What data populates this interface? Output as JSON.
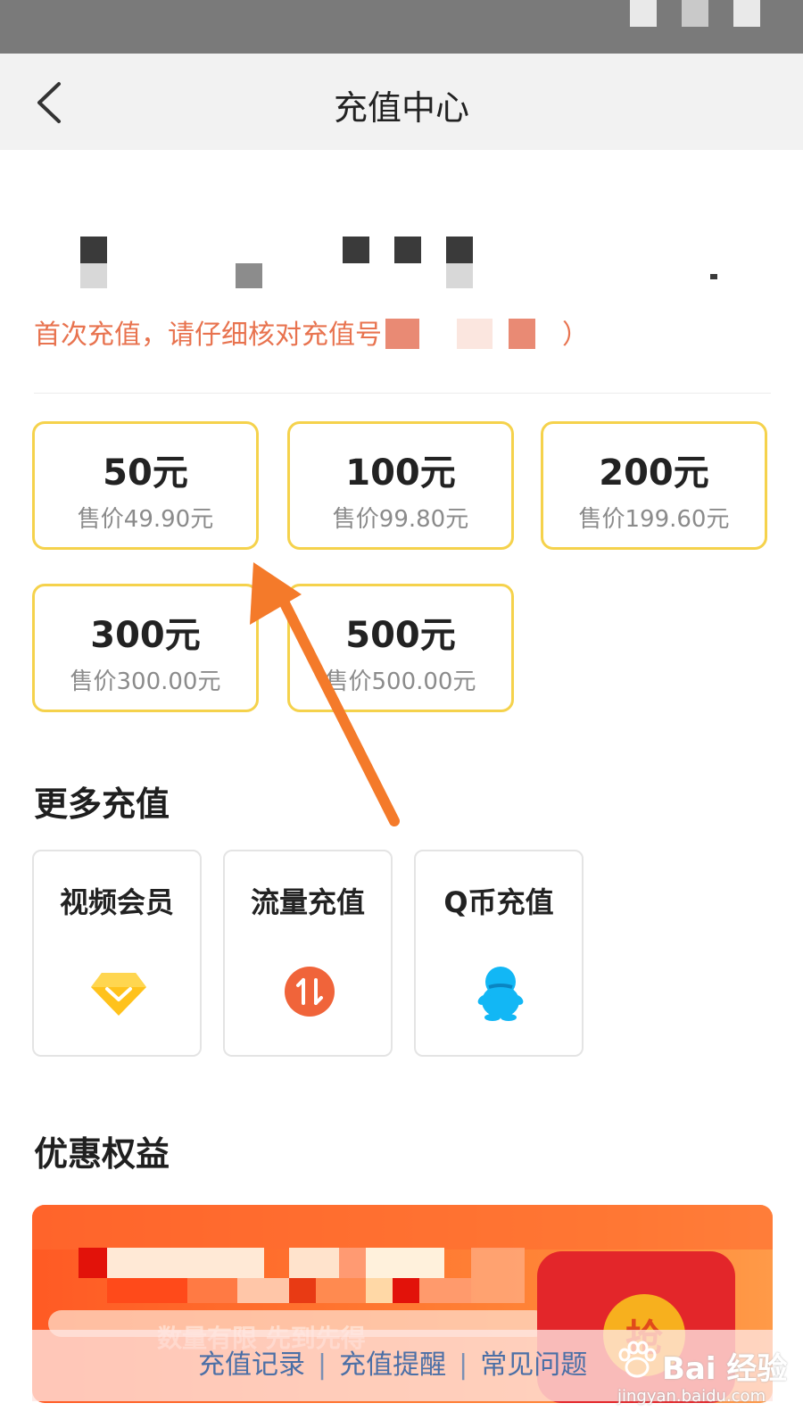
{
  "nav": {
    "title": "充值中心"
  },
  "account": {
    "notice": "首次充值，请仔细核对充值号",
    "notice_tail": "）"
  },
  "amounts": [
    {
      "value": "50元",
      "price": "售价49.90元"
    },
    {
      "value": "100元",
      "price": "售价99.80元"
    },
    {
      "value": "200元",
      "price": "售价199.60元"
    },
    {
      "value": "300元",
      "price": "售价300.00元"
    },
    {
      "value": "500元",
      "price": "售价500.00元"
    }
  ],
  "more": {
    "title": "更多充值",
    "items": [
      {
        "label": "视频会员",
        "icon": "diamond-icon"
      },
      {
        "label": "流量充值",
        "icon": "data-traffic-icon"
      },
      {
        "label": "Q币充值",
        "icon": "qq-penguin-icon"
      }
    ]
  },
  "benefits": {
    "title": "优惠权益",
    "banner_text": "数量有限 先到先得",
    "coin_char": "抢"
  },
  "footer": {
    "links": [
      "充值记录",
      "充值提醒",
      "常见问题"
    ]
  },
  "watermark": {
    "text": "Bai 经验",
    "url": "jingyan.baidu.com"
  },
  "colors": {
    "accent_border": "#f5d24c",
    "notice": "#e8734f",
    "link": "#4b6fa6",
    "arrow": "#f47a2a",
    "banner": "#ff6a2a"
  }
}
